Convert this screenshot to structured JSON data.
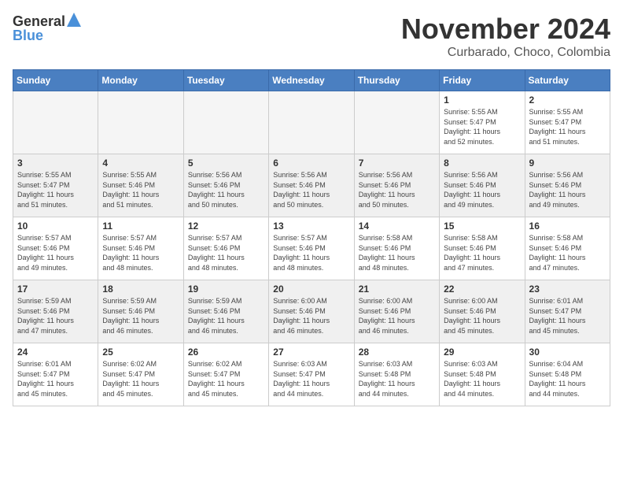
{
  "header": {
    "logo_general": "General",
    "logo_blue": "Blue",
    "month_year": "November 2024",
    "location": "Curbarado, Choco, Colombia"
  },
  "weekdays": [
    "Sunday",
    "Monday",
    "Tuesday",
    "Wednesday",
    "Thursday",
    "Friday",
    "Saturday"
  ],
  "weeks": [
    [
      {
        "day": "",
        "info": ""
      },
      {
        "day": "",
        "info": ""
      },
      {
        "day": "",
        "info": ""
      },
      {
        "day": "",
        "info": ""
      },
      {
        "day": "",
        "info": ""
      },
      {
        "day": "1",
        "info": "Sunrise: 5:55 AM\nSunset: 5:47 PM\nDaylight: 11 hours\nand 52 minutes."
      },
      {
        "day": "2",
        "info": "Sunrise: 5:55 AM\nSunset: 5:47 PM\nDaylight: 11 hours\nand 51 minutes."
      }
    ],
    [
      {
        "day": "3",
        "info": "Sunrise: 5:55 AM\nSunset: 5:47 PM\nDaylight: 11 hours\nand 51 minutes."
      },
      {
        "day": "4",
        "info": "Sunrise: 5:55 AM\nSunset: 5:46 PM\nDaylight: 11 hours\nand 51 minutes."
      },
      {
        "day": "5",
        "info": "Sunrise: 5:56 AM\nSunset: 5:46 PM\nDaylight: 11 hours\nand 50 minutes."
      },
      {
        "day": "6",
        "info": "Sunrise: 5:56 AM\nSunset: 5:46 PM\nDaylight: 11 hours\nand 50 minutes."
      },
      {
        "day": "7",
        "info": "Sunrise: 5:56 AM\nSunset: 5:46 PM\nDaylight: 11 hours\nand 50 minutes."
      },
      {
        "day": "8",
        "info": "Sunrise: 5:56 AM\nSunset: 5:46 PM\nDaylight: 11 hours\nand 49 minutes."
      },
      {
        "day": "9",
        "info": "Sunrise: 5:56 AM\nSunset: 5:46 PM\nDaylight: 11 hours\nand 49 minutes."
      }
    ],
    [
      {
        "day": "10",
        "info": "Sunrise: 5:57 AM\nSunset: 5:46 PM\nDaylight: 11 hours\nand 49 minutes."
      },
      {
        "day": "11",
        "info": "Sunrise: 5:57 AM\nSunset: 5:46 PM\nDaylight: 11 hours\nand 48 minutes."
      },
      {
        "day": "12",
        "info": "Sunrise: 5:57 AM\nSunset: 5:46 PM\nDaylight: 11 hours\nand 48 minutes."
      },
      {
        "day": "13",
        "info": "Sunrise: 5:57 AM\nSunset: 5:46 PM\nDaylight: 11 hours\nand 48 minutes."
      },
      {
        "day": "14",
        "info": "Sunrise: 5:58 AM\nSunset: 5:46 PM\nDaylight: 11 hours\nand 48 minutes."
      },
      {
        "day": "15",
        "info": "Sunrise: 5:58 AM\nSunset: 5:46 PM\nDaylight: 11 hours\nand 47 minutes."
      },
      {
        "day": "16",
        "info": "Sunrise: 5:58 AM\nSunset: 5:46 PM\nDaylight: 11 hours\nand 47 minutes."
      }
    ],
    [
      {
        "day": "17",
        "info": "Sunrise: 5:59 AM\nSunset: 5:46 PM\nDaylight: 11 hours\nand 47 minutes."
      },
      {
        "day": "18",
        "info": "Sunrise: 5:59 AM\nSunset: 5:46 PM\nDaylight: 11 hours\nand 46 minutes."
      },
      {
        "day": "19",
        "info": "Sunrise: 5:59 AM\nSunset: 5:46 PM\nDaylight: 11 hours\nand 46 minutes."
      },
      {
        "day": "20",
        "info": "Sunrise: 6:00 AM\nSunset: 5:46 PM\nDaylight: 11 hours\nand 46 minutes."
      },
      {
        "day": "21",
        "info": "Sunrise: 6:00 AM\nSunset: 5:46 PM\nDaylight: 11 hours\nand 46 minutes."
      },
      {
        "day": "22",
        "info": "Sunrise: 6:00 AM\nSunset: 5:46 PM\nDaylight: 11 hours\nand 45 minutes."
      },
      {
        "day": "23",
        "info": "Sunrise: 6:01 AM\nSunset: 5:47 PM\nDaylight: 11 hours\nand 45 minutes."
      }
    ],
    [
      {
        "day": "24",
        "info": "Sunrise: 6:01 AM\nSunset: 5:47 PM\nDaylight: 11 hours\nand 45 minutes."
      },
      {
        "day": "25",
        "info": "Sunrise: 6:02 AM\nSunset: 5:47 PM\nDaylight: 11 hours\nand 45 minutes."
      },
      {
        "day": "26",
        "info": "Sunrise: 6:02 AM\nSunset: 5:47 PM\nDaylight: 11 hours\nand 45 minutes."
      },
      {
        "day": "27",
        "info": "Sunrise: 6:03 AM\nSunset: 5:47 PM\nDaylight: 11 hours\nand 44 minutes."
      },
      {
        "day": "28",
        "info": "Sunrise: 6:03 AM\nSunset: 5:48 PM\nDaylight: 11 hours\nand 44 minutes."
      },
      {
        "day": "29",
        "info": "Sunrise: 6:03 AM\nSunset: 5:48 PM\nDaylight: 11 hours\nand 44 minutes."
      },
      {
        "day": "30",
        "info": "Sunrise: 6:04 AM\nSunset: 5:48 PM\nDaylight: 11 hours\nand 44 minutes."
      }
    ]
  ]
}
